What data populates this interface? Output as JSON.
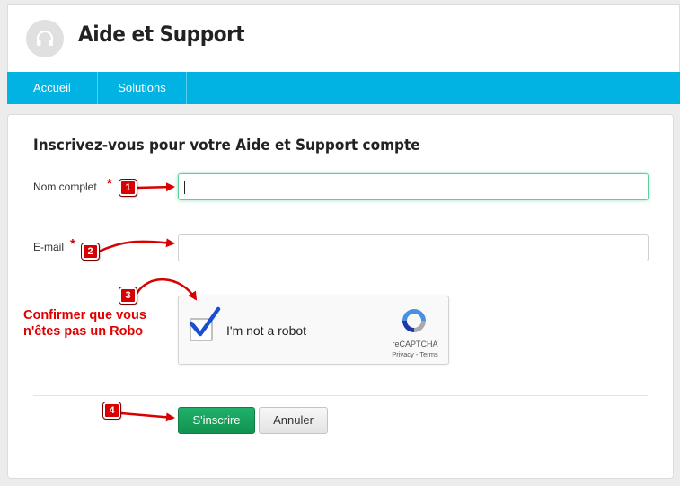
{
  "header": {
    "title": "Aide et Support",
    "logo_icon": "headset-icon"
  },
  "nav": {
    "items": [
      {
        "label": "Accueil"
      },
      {
        "label": "Solutions"
      }
    ]
  },
  "form": {
    "title": "Inscrivez-vous pour votre Aide et Support compte",
    "fullname": {
      "label": "Nom complet",
      "required_mark": "*",
      "value": ""
    },
    "email": {
      "label": "E-mail",
      "required_mark": "*",
      "value": ""
    },
    "captcha": {
      "text": "I'm not a robot",
      "brand": "reCAPTCHA",
      "links": "Privacy - Terms",
      "checked": true
    },
    "submit_label": "S'inscrire",
    "cancel_label": "Annuler"
  },
  "annotations": {
    "badges": [
      "1",
      "2",
      "3",
      "4"
    ],
    "note": "Confirmer que vous n'êtes pas un Robo",
    "color": "#d80000"
  },
  "colors": {
    "nav": "#00b3e3",
    "primary_button": "#12934f"
  }
}
